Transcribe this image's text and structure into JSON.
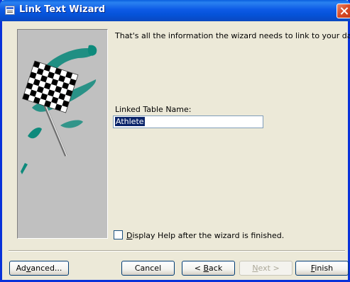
{
  "window": {
    "title": "Link Text Wizard"
  },
  "content": {
    "intro_text": "That's all the information the wizard needs to link to your data.",
    "linked_table_label": "Linked Table Name:",
    "linked_table_value": "Athlete",
    "help_checkbox": {
      "checked": false,
      "label_mnemonic": "D",
      "label_rest": "isplay Help after the wizard is finished."
    }
  },
  "buttons": {
    "advanced": {
      "before": "Ad",
      "mnemonic": "v",
      "after": "anced..."
    },
    "cancel": "Cancel",
    "back": {
      "before": "< ",
      "mnemonic": "B",
      "after": "ack"
    },
    "next": {
      "before": "",
      "mnemonic": "N",
      "after": "ext >"
    },
    "finish": {
      "before": "",
      "mnemonic": "F",
      "after": "inish"
    }
  },
  "colors": {
    "titlebar": "#0553d8",
    "dialog_bg": "#ece9d8",
    "art_panel_bg": "#c0c0c0",
    "art_accent": "#0e8a7c",
    "selection": "#0a246a"
  },
  "icons": {
    "title": "form-icon",
    "close": "close-icon",
    "art": "checkered-flag-icon"
  }
}
